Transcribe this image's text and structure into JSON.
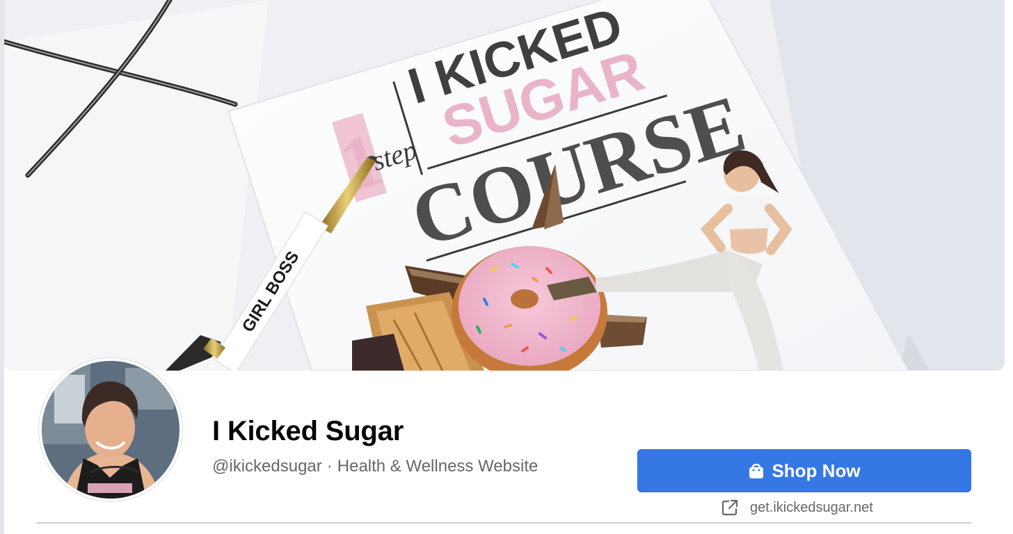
{
  "profile": {
    "name": "I Kicked Sugar",
    "handle": "@ikickedsugar",
    "separator": "·",
    "category": "Health & Wellness Website"
  },
  "cover": {
    "book_word_kicked": "I KICKED",
    "book_word_sugar": "SUGAR",
    "book_word_course": "COURSE",
    "book_step_number": "1",
    "book_step_word": "step",
    "pen_text": "GIRL BOSS"
  },
  "actions": {
    "shop_label": "Shop Now",
    "website_label": "get.ikickedsugar.net"
  },
  "colors": {
    "accent": "#3578e5",
    "text_primary": "#050505",
    "text_secondary": "#65676b",
    "cover_pink": "#eab4c8",
    "cover_gray": "#4e4e4e"
  },
  "icons": {
    "shop": "shopping-bag-icon",
    "link": "external-link-icon"
  }
}
